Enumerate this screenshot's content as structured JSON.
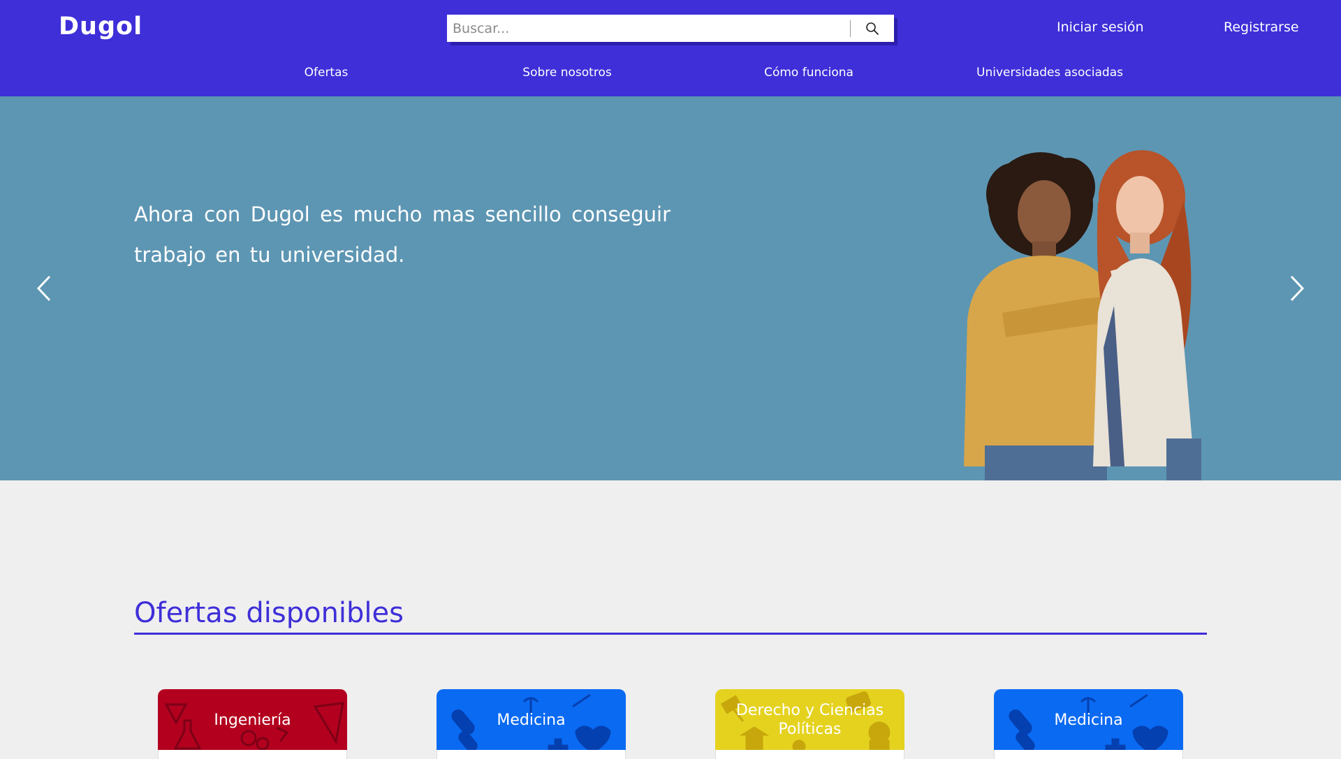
{
  "header": {
    "logo": "Dugol",
    "search": {
      "placeholder": "Buscar...",
      "value": ""
    },
    "login": "Iniciar sesión",
    "register": "Registrarse",
    "nav": [
      "Ofertas",
      "Sobre nosotros",
      "Cómo funciona",
      "Universidades asociadas"
    ]
  },
  "hero": {
    "text": "Ahora con Dugol es mucho mas sencillo conseguir trabajo en tu universidad."
  },
  "offers": {
    "title": "Ofertas disponibles",
    "cards": [
      {
        "label": "Ingeniería",
        "color": "#b3001f"
      },
      {
        "label": "Medicina",
        "color": "#0a6af2"
      },
      {
        "label": "Derecho y Ciencias Políticas",
        "color": "#e5d21f"
      },
      {
        "label": "Medicina",
        "color": "#0a6af2"
      }
    ]
  },
  "colors": {
    "brand": "#3e2fd8",
    "hero_bg": "#5d96b3",
    "page_bg": "#efefef"
  },
  "icons": [
    "search-icon",
    "chevron-left-icon",
    "chevron-right-icon"
  ]
}
